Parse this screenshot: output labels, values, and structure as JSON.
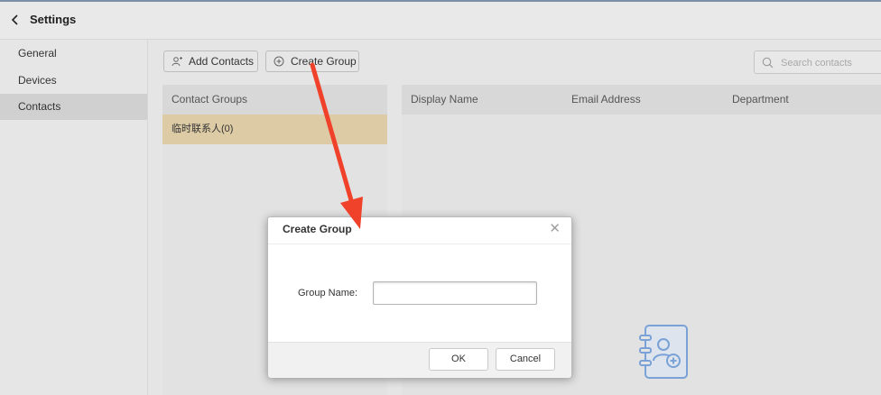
{
  "header": {
    "title": "Settings",
    "back_icon": "chevron-left-icon"
  },
  "sidebar": {
    "items": [
      {
        "label": "General",
        "active": false
      },
      {
        "label": "Devices",
        "active": false
      },
      {
        "label": "Contacts",
        "active": true
      }
    ]
  },
  "toolbar": {
    "add_contacts_label": "Add Contacts",
    "add_contacts_icon": "add-user-icon",
    "create_group_label": "Create Group",
    "create_group_icon": "plus-circle-icon",
    "search_placeholder": "Search contacts"
  },
  "groups": {
    "header": "Contact Groups",
    "items": [
      {
        "label": "临时联系人(0)",
        "selected": true
      }
    ]
  },
  "contacts_table": {
    "columns": [
      "Display Name",
      "Email Address",
      "Department"
    ],
    "rows": []
  },
  "dialog": {
    "title": "Create Group",
    "field_label": "Group Name:",
    "field_value": "",
    "ok_label": "OK",
    "cancel_label": "Cancel"
  },
  "colors": {
    "selected_group": "#dccba5",
    "annotation_arrow": "#f0412a"
  }
}
